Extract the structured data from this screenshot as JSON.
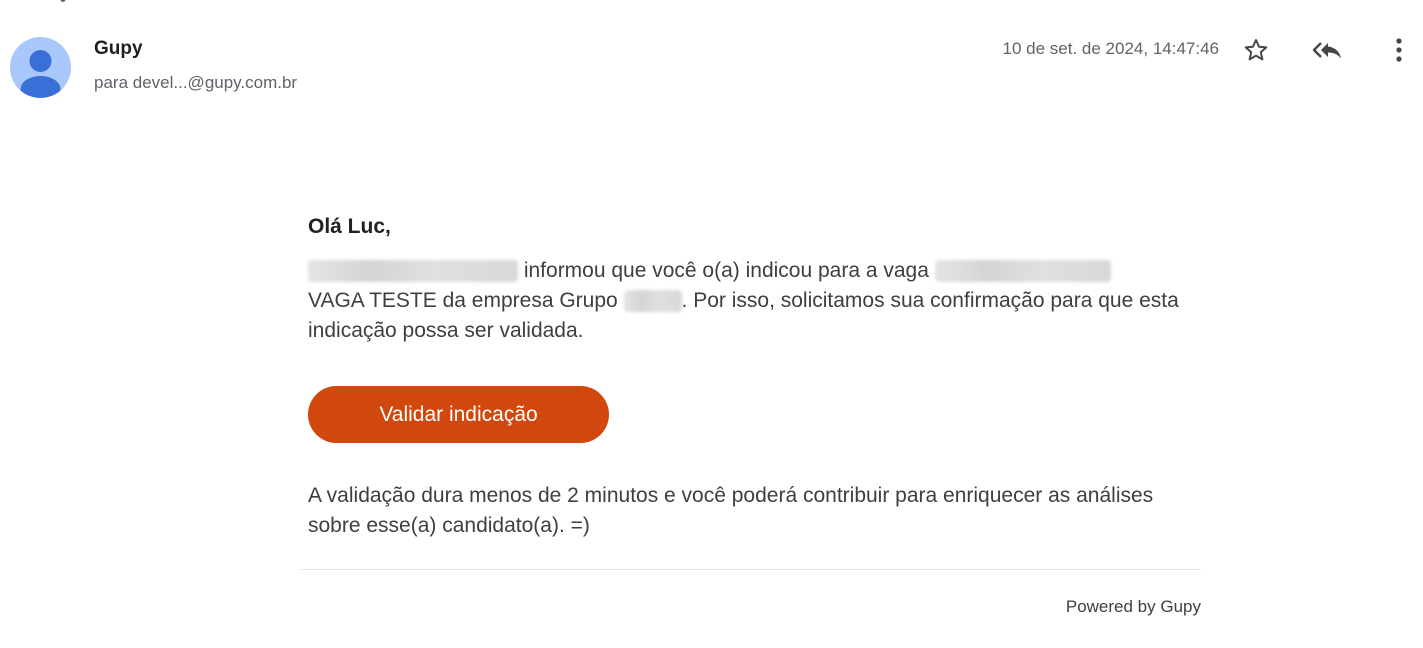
{
  "header": {
    "sender_name": "Gupy",
    "recipient": "para devel...@gupy.com.br",
    "date": "10 de set. de 2024, 14:47:46",
    "icons": {
      "avatar": "person-avatar-icon",
      "star": "star-icon",
      "reply_all": "reply-all-icon",
      "more": "more-vert-icon"
    }
  },
  "body": {
    "greeting": "Olá Luc,",
    "p1_text1": " informou que você o(a) indicou para a vaga ",
    "p1_text2": "VAGA TESTE da empresa Grupo ",
    "p1_text3": ". Por isso, solicitamos sua confirmação para que esta indicação possa ser validada.",
    "cta_label": "Validar indicação",
    "p2": "A validação dura menos de 2 minutos e você poderá contribuir para enriquecer as análises sobre esse(a) candidato(a). =)"
  },
  "footer": {
    "powered_by": "Powered by Gupy"
  },
  "colors": {
    "accent": "#d0480d",
    "avatar_bg": "#a8c7fa",
    "avatar_fg": "#3b6fd8"
  }
}
